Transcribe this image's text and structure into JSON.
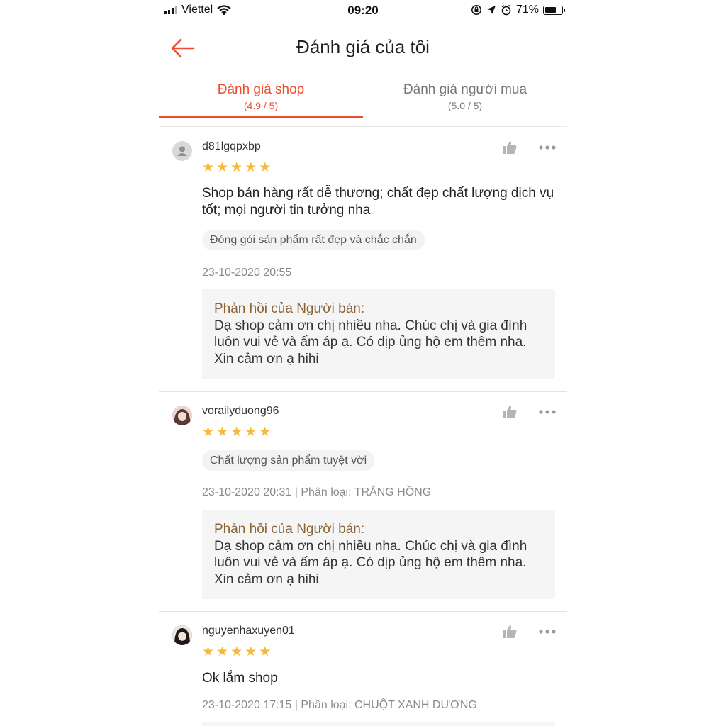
{
  "status_bar": {
    "carrier": "Viettel",
    "time": "09:20",
    "battery": "71%",
    "battery_level": 0.71
  },
  "header": {
    "title": "Đánh giá của tôi",
    "back_icon": "back-arrow-icon"
  },
  "tabs": [
    {
      "label": "Đánh giá shop",
      "score": "(4.9 / 5)",
      "active": true
    },
    {
      "label": "Đánh giá người mua",
      "score": "(5.0 / 5)",
      "active": false
    }
  ],
  "colors": {
    "accent": "#ee4d2d",
    "star": "#f6b93b",
    "reply_title": "#8b6235"
  },
  "reviews": [
    {
      "username": "d81lgqpxbp",
      "rating": 5,
      "text": "Shop bán hàng rất dễ thương; chất đẹp chất lượng dịch vụ tốt; mọi người tin tưởng nha",
      "tag": "Đóng gói sản phẩm rất đẹp và chắc chắn",
      "meta": "23-10-2020 20:55",
      "reply_title": "Phản hồi của Người bán:",
      "reply_text": "Dạ shop cảm ơn chị nhiều nha. Chúc chị và gia đình luôn vui vẻ và ấm áp ạ. Có dịp ủng hộ em thêm nha. Xin cảm ơn ạ hihi"
    },
    {
      "username": "vorailyduong96",
      "rating": 5,
      "tag": "Chất lượng sản phẩm tuyệt vời",
      "meta": "23-10-2020 20:31 | Phân loại: TRẮNG HỒNG",
      "reply_title": "Phản hồi của Người bán:",
      "reply_text": "Dạ shop cảm ơn chị nhiều nha. Chúc chị và gia đình luôn vui vẻ và ấm áp ạ. Có dịp ủng hộ em thêm nha. Xin cảm ơn ạ hihi"
    },
    {
      "username": "nguyenhaxuyen01",
      "rating": 5,
      "text": "Ok lắm shop",
      "meta": "23-10-2020 17:15 | Phân loại: CHUỘT XANH DƯƠNG"
    }
  ]
}
